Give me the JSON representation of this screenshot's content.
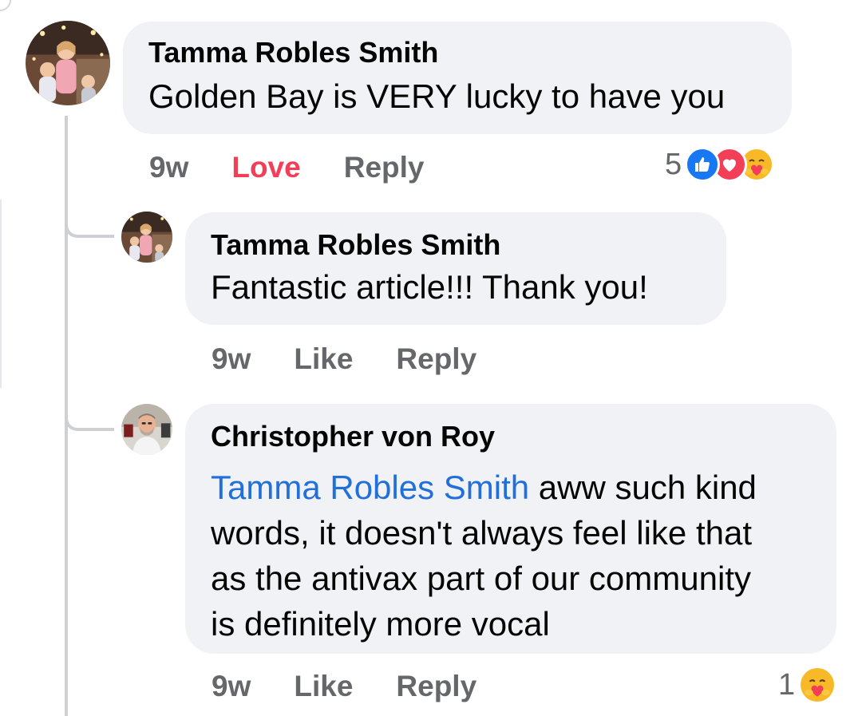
{
  "comments": [
    {
      "author": "Tamma Robles Smith",
      "text": "Golden Bay is VERY lucky to have you",
      "time": "9w",
      "reaction_label": "Love",
      "reply_label": "Reply",
      "reaction_count": "5",
      "reaction_icons": [
        "like-icon",
        "love-icon",
        "care-icon"
      ]
    },
    {
      "author": "Tamma Robles Smith",
      "text": "Fantastic article!!! Thank you!",
      "time": "9w",
      "reaction_label": "Like",
      "reply_label": "Reply"
    },
    {
      "author": "Christopher von Roy",
      "mention": "Tamma Robles Smith",
      "text_line1": " aww such kind",
      "text_line2": "words, it doesn't always feel like that",
      "text_line3": "as the antivax part of our community",
      "text_line4": "is definitely more vocal",
      "time": "9w",
      "reaction_label": "Like",
      "reply_label": "Reply",
      "reaction_count": "1",
      "reaction_icons": [
        "care-icon"
      ]
    }
  ],
  "colors": {
    "bubble": "#f0f2f5",
    "meta_gray": "#65676b",
    "love_red": "#f33e58",
    "mention_blue": "#216fdb",
    "like_blue": "#1877f2",
    "care_yellow": "#f7b928"
  }
}
